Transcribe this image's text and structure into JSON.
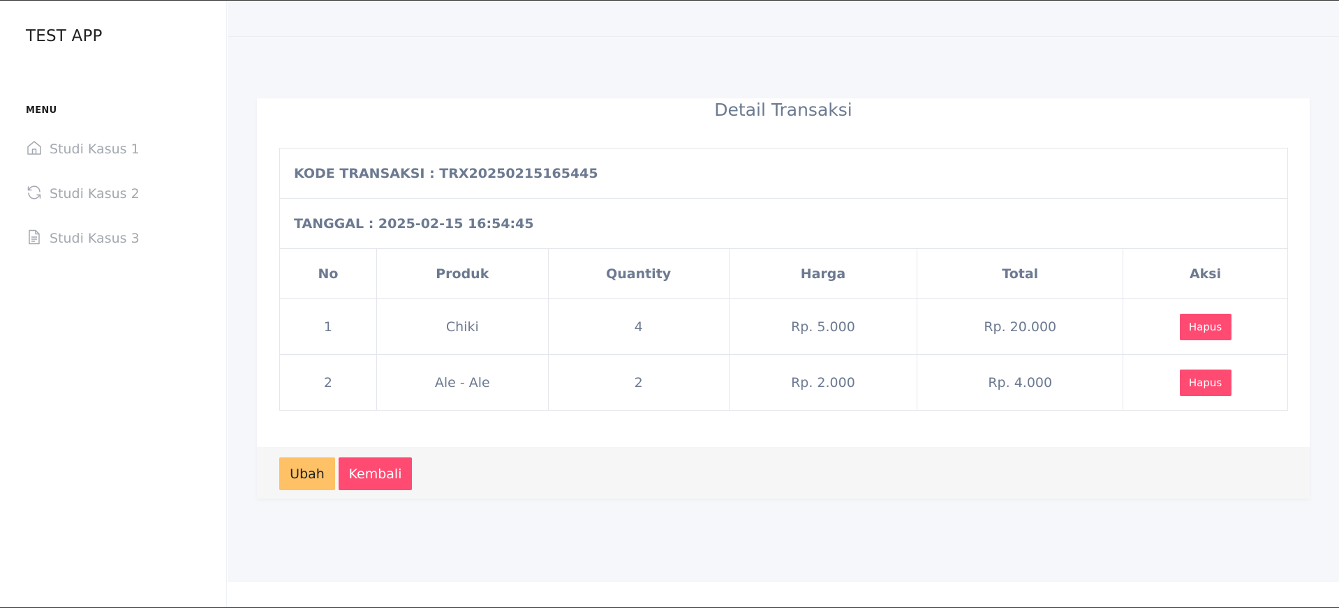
{
  "app": {
    "title": "TEST APP"
  },
  "sidebar": {
    "menu_title": "MENU",
    "items": [
      {
        "label": "Studi Kasus 1",
        "icon": "home-icon"
      },
      {
        "label": "Studi Kasus 2",
        "icon": "refresh-icon"
      },
      {
        "label": "Studi Kasus 3",
        "icon": "document-icon"
      }
    ]
  },
  "card": {
    "title": "Detail Transaksi",
    "kode": "KODE TRANSAKSI : TRX20250215165445",
    "tanggal": "TANGGAL : 2025-02-15 16:54:45",
    "columns": [
      "No",
      "Produk",
      "Quantity",
      "Harga",
      "Total",
      "Aksi"
    ],
    "rows": [
      {
        "no": "1",
        "produk": "Chiki",
        "quantity": "4",
        "harga": "Rp. 5.000",
        "total": "Rp. 20.000",
        "aksi": "Hapus"
      },
      {
        "no": "2",
        "produk": "Ale - Ale",
        "quantity": "2",
        "harga": "Rp. 2.000",
        "total": "Rp. 4.000",
        "aksi": "Hapus"
      }
    ]
  },
  "buttons": {
    "ubah": "Ubah",
    "kembali": "Kembali"
  },
  "colors": {
    "danger": "#ff4b72",
    "warning": "#ffc165",
    "text": "#6c7a91",
    "background": "#f5f7fb"
  }
}
